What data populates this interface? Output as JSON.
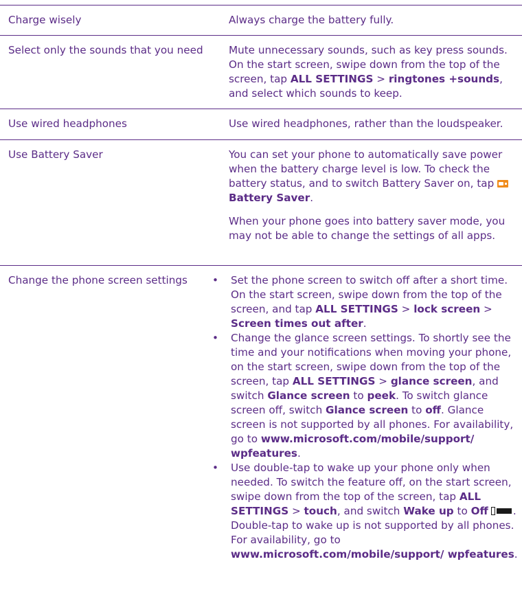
{
  "rows": [
    {
      "left": "Charge wisely",
      "right": "Always charge the battery fully."
    },
    {
      "left": "Select only the sounds that you need",
      "right": {
        "t1": "Mute unnecessary sounds, such as key press sounds. On the start screen, swipe down from the top of the screen, tap ",
        "b1": "ALL SETTINGS",
        "t2": " > ",
        "b2": "ringtones +sounds",
        "t3": ", and select which sounds to keep."
      }
    },
    {
      "left": "Use wired headphones",
      "right": "Use wired headphones, rather than the loudspeaker."
    },
    {
      "left": "Use Battery Saver",
      "right": {
        "p1_t1": "You can set your phone to automatically save power when the battery charge level is low. To check the battery status, and to switch Battery Saver on, tap ",
        "p1_icon": "battery-saver-icon",
        "p1_b1": "Battery Saver",
        "p1_t2": ".",
        "p2": "When your phone goes into battery saver mode, you may not be able to change the settings of all apps."
      }
    },
    {
      "left": "Change the phone screen settings",
      "bullets": [
        {
          "t1": "Set the phone screen to switch off after a short time. On the start screen, swipe down from the top of the screen, and tap ",
          "b1": "ALL SETTINGS",
          "t2": " > ",
          "b2": "lock screen",
          "t3": " > ",
          "b3": "Screen times out after",
          "t4": "."
        },
        {
          "t1": "Change the glance screen settings. To shortly see the time and your notifications when moving your phone, on the start screen, swipe down from the top of the screen, tap ",
          "b1": "ALL SETTINGS",
          "t2": " > ",
          "b2": "glance screen",
          "t3": ", and switch ",
          "b3": "Glance screen",
          "t4": " to ",
          "b4": "peek",
          "t5": ". To switch glance screen off, switch ",
          "b5": "Glance screen",
          "t6": " to ",
          "b6": "off",
          "t7": ". Glance screen is not supported by all phones. For availability, go to ",
          "b7": "www.microsoft.com/mobile/support/ wpfeatures",
          "t8": "."
        },
        {
          "t1": "Use double-tap to wake up your phone only when needed. To switch the feature off, on the start screen, swipe down from the top of the screen, tap ",
          "b1": "ALL SETTINGS",
          "t2": " > ",
          "b2": "touch",
          "t3": ", and switch ",
          "b3": "Wake up",
          "t4": " to ",
          "b4": "Off",
          "icon": "toggle-off-icon",
          "t5": ". Double-tap to wake up is not supported by all phones. For availability, go to ",
          "b5": "www.microsoft.com/mobile/support/ wpfeatures",
          "t6": "."
        }
      ]
    }
  ],
  "colors": {
    "text": "#5b2c87",
    "rule": "#5b2c87",
    "battery_icon": "#f08c1c"
  }
}
